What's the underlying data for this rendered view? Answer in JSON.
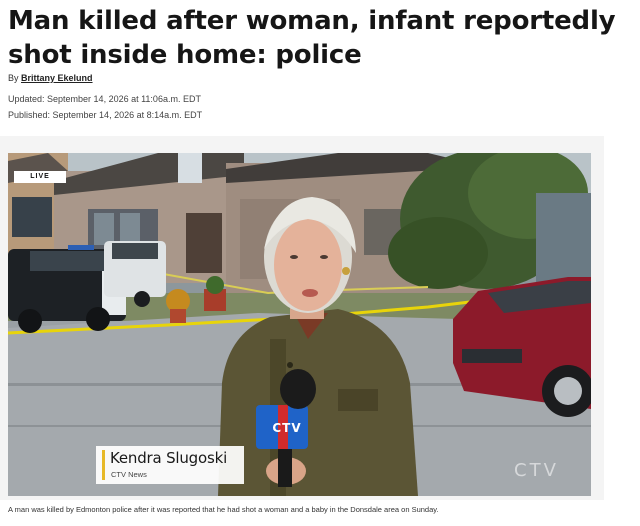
{
  "article": {
    "headline": "Man killed after woman, infant reportedly shot inside home: police",
    "byline_prefix": "By",
    "author": "Brittany Ekelund",
    "updated": "Updated: September 14, 2026 at 11:06a.m. EDT",
    "published": "Published: September 14, 2026 at 8:14a.m. EDT"
  },
  "video": {
    "live_badge": "LIVE",
    "reporter_name": "Kendra Slugoski",
    "reporter_org": "CTV News",
    "watermark": "CTV",
    "mic_flag": "CTV"
  },
  "caption": "A man was killed by Edmonton police after it was reported that he had shot a woman and a baby in the Donsdale area on Sunday.",
  "colors": {
    "lower_third_accent": "#e7b928",
    "police_tape": "#e8d40a",
    "mic_flag_blue": "#1f63c8",
    "mic_flag_red": "#d22b2b"
  }
}
